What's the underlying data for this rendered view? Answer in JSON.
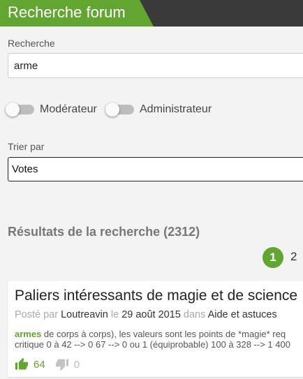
{
  "header": {
    "title": "Recherche forum"
  },
  "search": {
    "label": "Recherche",
    "value": "arme"
  },
  "filters": [
    {
      "label": "Modérateur",
      "checked": false
    },
    {
      "label": "Administrateur",
      "checked": false
    }
  ],
  "sort": {
    "label": "Trier par",
    "selected": "Votes"
  },
  "results": {
    "title": "Résultats de la recherche (2312)",
    "pages": [
      "1",
      "2"
    ],
    "current_page": "1"
  },
  "post": {
    "title": "Paliers intéressants de magie et de science",
    "posted_by": "Posté par",
    "author": "Loutreavin",
    "on_label": "le",
    "date": "29 août 2015",
    "in_label": "dans",
    "category": "Aide et astuces",
    "excerpt_highlight": "armes",
    "excerpt_line1": " de corps à corps), les valeurs sont les points de *magie* req",
    "excerpt_line2": "critique 0 à 42 --> 0 67 --> 0 ou 1 (équiprobable) 100 à 328 --> 1 400",
    "upvotes": "64",
    "downvotes": "0"
  },
  "colors": {
    "accent": "#63a531",
    "header_bg": "#3a3a3a"
  }
}
